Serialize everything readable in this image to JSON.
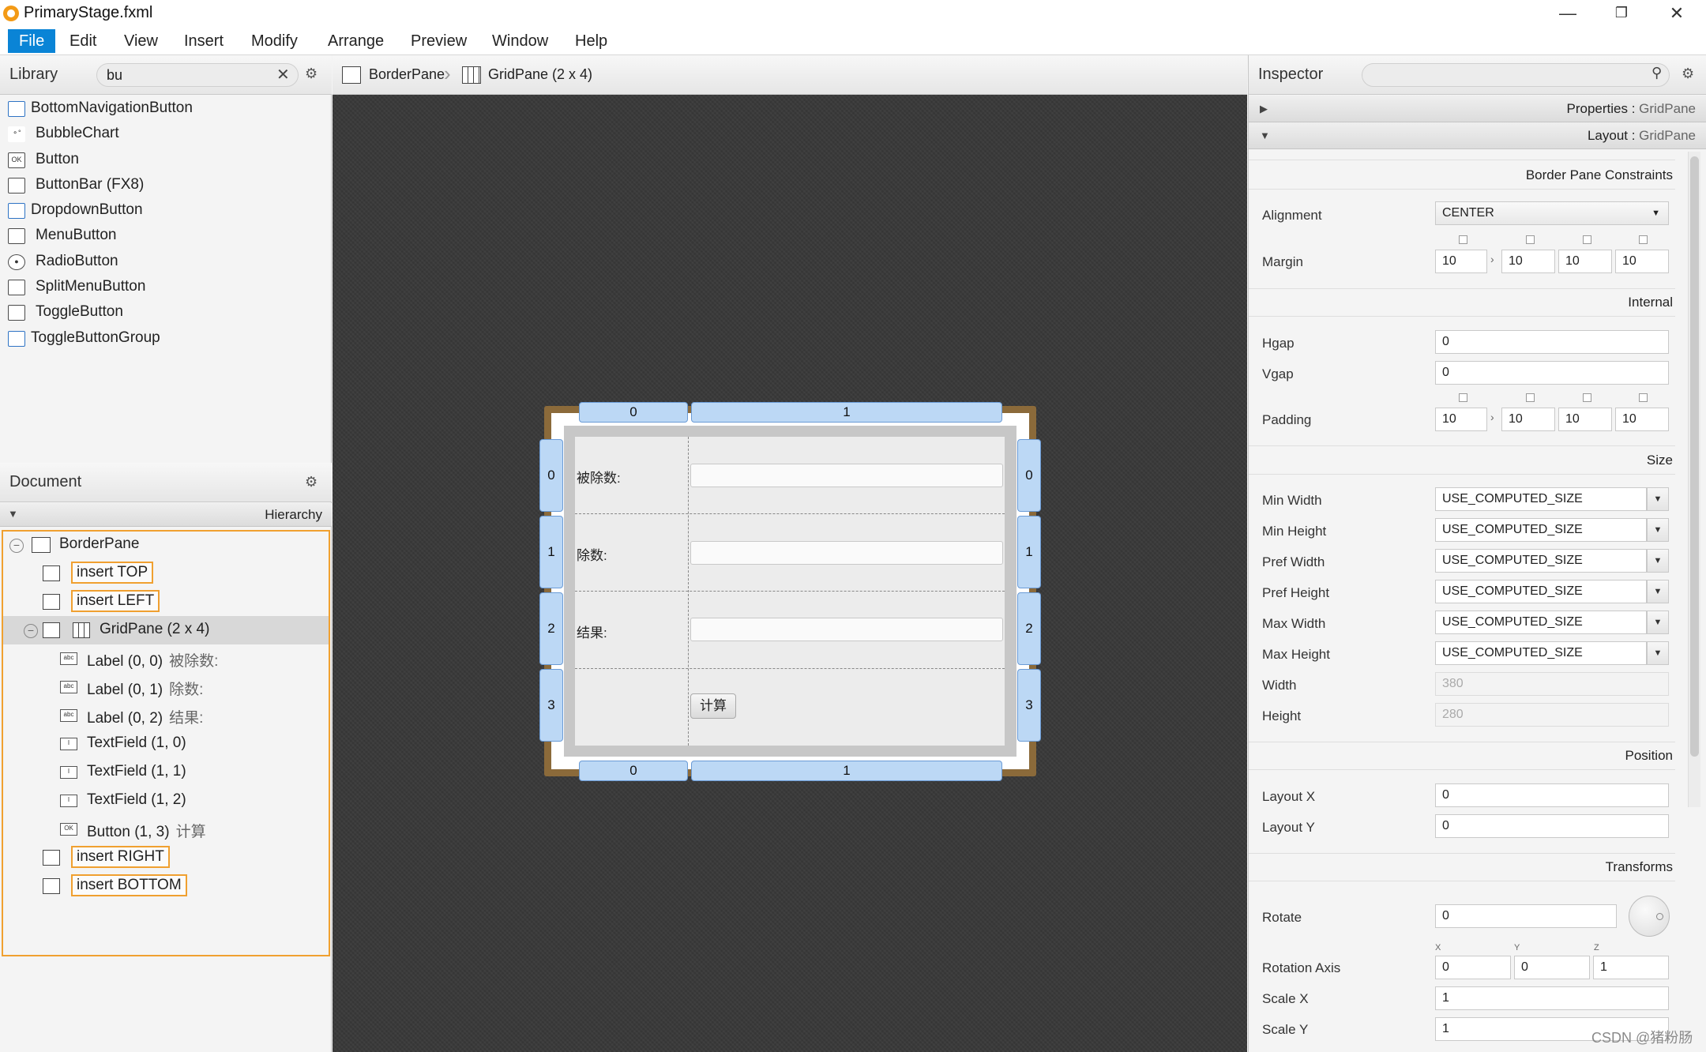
{
  "window": {
    "title": "PrimaryStage.fxml",
    "minimize": "—",
    "restore": "❐",
    "close": "✕"
  },
  "menu": [
    "File",
    "Edit",
    "View",
    "Insert",
    "Modify",
    "Arrange",
    "Preview",
    "Window",
    "Help"
  ],
  "library": {
    "title": "Library",
    "search_value": "bu",
    "items": [
      "BottomNavigationButton",
      "BubbleChart",
      "Button",
      "ButtonBar  (FX8)",
      "DropdownButton",
      "MenuButton",
      "RadioButton",
      "SplitMenuButton",
      "ToggleButton",
      "ToggleButtonGroup"
    ],
    "button_icon_text": "OK"
  },
  "document": {
    "title": "Document",
    "hierarchy_label": "Hierarchy",
    "tree": {
      "borderpane": "BorderPane",
      "insert_top": "insert TOP",
      "insert_left": "insert LEFT",
      "gridpane": "GridPane (2 x 4)",
      "children": [
        {
          "label": "Label (0, 0)",
          "extra": "被除数:",
          "icon": "abc"
        },
        {
          "label": "Label (0, 1)",
          "extra": "除数:",
          "icon": "abc"
        },
        {
          "label": "Label (0, 2)",
          "extra": "结果:",
          "icon": "abc"
        },
        {
          "label": "TextField (1, 0)",
          "extra": "",
          "icon": "I"
        },
        {
          "label": "TextField (1, 1)",
          "extra": "",
          "icon": "I"
        },
        {
          "label": "TextField (1, 2)",
          "extra": "",
          "icon": "I"
        },
        {
          "label": "Button (1, 3)",
          "extra": "计算",
          "icon": "OK"
        }
      ],
      "insert_right": "insert RIGHT",
      "insert_bottom": "insert BOTTOM"
    }
  },
  "breadcrumb": {
    "items": [
      "BorderPane",
      "GridPane (2 x 4)"
    ]
  },
  "design": {
    "col_labels": [
      "0",
      "1"
    ],
    "row_labels": [
      "0",
      "1",
      "2",
      "3"
    ],
    "form": {
      "dividend_label": "被除数:",
      "divisor_label": "除数:",
      "result_label": "结果:",
      "calc_button": "计算"
    }
  },
  "inspector": {
    "title": "Inspector",
    "properties_bar": {
      "name": "Properties",
      "target": "GridPane"
    },
    "layout_bar": {
      "name": "Layout",
      "target": "GridPane"
    },
    "border_pane_constraints": "Border Pane Constraints",
    "alignment": {
      "label": "Alignment",
      "value": "CENTER"
    },
    "margin": {
      "label": "Margin",
      "values": [
        "10",
        "10",
        "10",
        "10"
      ]
    },
    "internal": "Internal",
    "hgap": {
      "label": "Hgap",
      "value": "0"
    },
    "vgap": {
      "label": "Vgap",
      "value": "0"
    },
    "padding": {
      "label": "Padding",
      "values": [
        "10",
        "10",
        "10",
        "10"
      ]
    },
    "size": "Size",
    "size_rows": [
      {
        "label": "Min Width",
        "value": "USE_COMPUTED_SIZE"
      },
      {
        "label": "Min Height",
        "value": "USE_COMPUTED_SIZE"
      },
      {
        "label": "Pref Width",
        "value": "USE_COMPUTED_SIZE"
      },
      {
        "label": "Pref Height",
        "value": "USE_COMPUTED_SIZE"
      },
      {
        "label": "Max Width",
        "value": "USE_COMPUTED_SIZE"
      },
      {
        "label": "Max Height",
        "value": "USE_COMPUTED_SIZE"
      }
    ],
    "width": {
      "label": "Width",
      "value": "380"
    },
    "height": {
      "label": "Height",
      "value": "280"
    },
    "position": "Position",
    "layout_x": {
      "label": "Layout X",
      "value": "0"
    },
    "layout_y": {
      "label": "Layout Y",
      "value": "0"
    },
    "transforms": "Transforms",
    "rotate": {
      "label": "Rotate",
      "value": "0"
    },
    "rotation_axis": {
      "label": "Rotation Axis",
      "axes": [
        "X",
        "Y",
        "Z"
      ],
      "values": [
        "0",
        "0",
        "1"
      ]
    },
    "scale_x": {
      "label": "Scale X",
      "value": "1"
    },
    "scale_y": {
      "label": "Scale Y",
      "value": "1"
    }
  },
  "watermark": "CSDN @猪粉肠",
  "colors": {
    "accent": "#0a84d6",
    "insert_outline": "#f0a030",
    "grid_tab": "#bcd8f5",
    "canvas": "#3a3a3a"
  }
}
